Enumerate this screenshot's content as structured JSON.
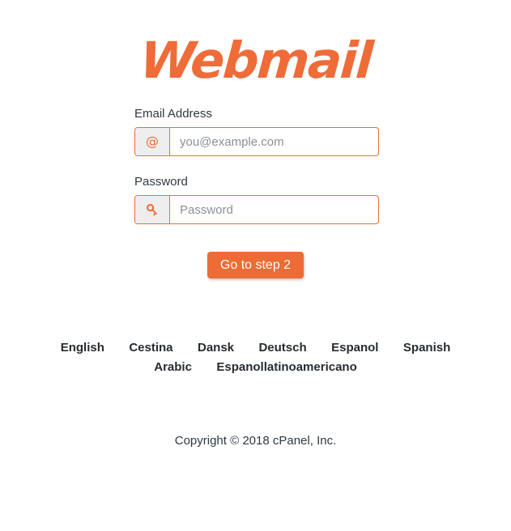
{
  "brand": {
    "logo_text": "Webmail",
    "accent_color": "#ef6c38",
    "button_color": "#ed6b35"
  },
  "form": {
    "email": {
      "label": "Email Address",
      "placeholder": "you@example.com",
      "value": "",
      "icon": "at-sign-icon"
    },
    "password": {
      "label": "Password",
      "placeholder": "Password",
      "value": "",
      "icon": "key-icon"
    },
    "submit_label": "Go to step 2"
  },
  "languages": [
    {
      "label": "English"
    },
    {
      "label": "Cestina"
    },
    {
      "label": "Dansk"
    },
    {
      "label": "Deutsch"
    },
    {
      "label": "Espanol"
    },
    {
      "label": "Spanish"
    },
    {
      "label": "Arabic"
    },
    {
      "label": "Espanollatinoamericano"
    }
  ],
  "footer": {
    "copyright": "Copyright © 2018 cPanel, Inc."
  }
}
